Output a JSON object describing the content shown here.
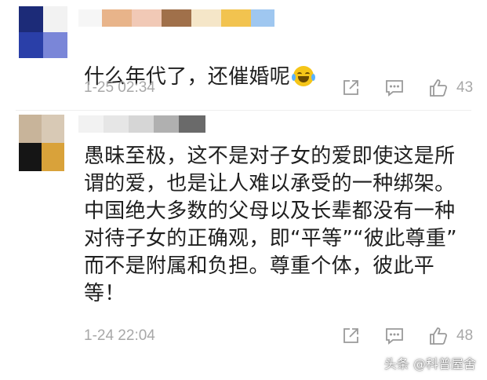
{
  "comments": [
    {
      "text": "什么年代了，还催婚呢",
      "emoji_icon": "laughing-crying-emoji",
      "time": "1-25 02:34",
      "like_count": "43",
      "avatar_colors": [
        "#1c2b78",
        "#f2f2f2",
        "#2a3fa8",
        "#7a86d8"
      ],
      "name_colors": [
        "#e8b48a",
        "#f1c9b6",
        "#a0704a",
        "#f2c34f",
        "#9fc7f0"
      ]
    },
    {
      "text": "愚昧至极，这不是对子女的爱即使这是所\n谓的爱，也是让人难以承受的一种绑架。\n中国绝大多数的父母以及长辈都没有一种\n对待子女的正确观，即“平等”“彼此尊重”\n而不是附属和负担。尊重个体，彼此平\n等！",
      "time": "1-24 22:04",
      "like_count": "48",
      "avatar_colors": [
        "#c8b49a",
        "#d8c9b5",
        "#151515",
        "#d9a23a"
      ],
      "name_colors": [
        "#e6e6e6",
        "#d6d6d6",
        "#b0b0b0",
        "#6a6a6a"
      ]
    }
  ],
  "icons": {
    "share": "share-icon",
    "reply": "comment-icon",
    "like": "thumbs-up-icon"
  },
  "watermark": "头条 @科普屋舍"
}
